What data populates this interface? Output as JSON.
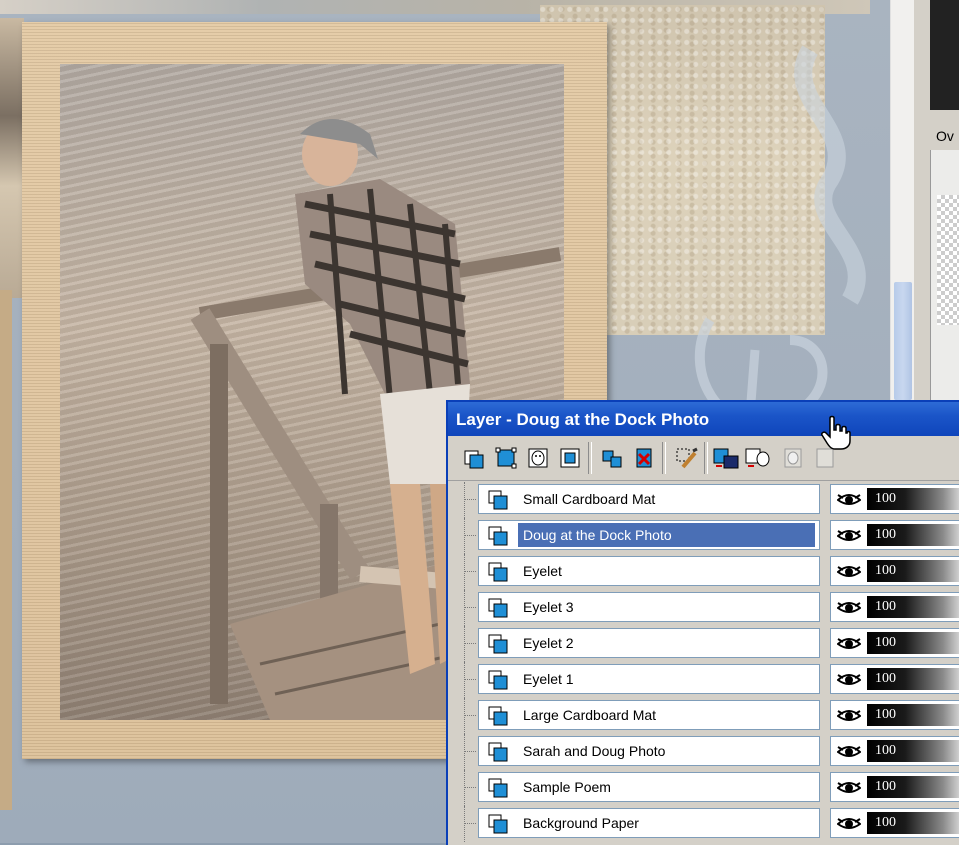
{
  "palette": {
    "title": "Layer - Doug at the Dock Photo",
    "toolbar": [
      {
        "name": "new-raster-layer-icon"
      },
      {
        "name": "new-vector-layer-icon"
      },
      {
        "name": "new-mask-layer-icon"
      },
      {
        "name": "new-adjustment-layer-icon"
      },
      {
        "name": "duplicate-layer-icon"
      },
      {
        "name": "delete-layer-icon"
      },
      {
        "name": "edit-selection-icon"
      },
      {
        "name": "load-mask-icon"
      },
      {
        "name": "hide-mask-icon"
      },
      {
        "name": "disabled-mask-icon"
      },
      {
        "name": "disabled-mask-icon-2"
      }
    ],
    "layers": [
      {
        "name": "Small Cardboard Mat",
        "opacity": "100",
        "selected": false
      },
      {
        "name": "Doug at the Dock Photo",
        "opacity": "100",
        "selected": true
      },
      {
        "name": "Eyelet",
        "opacity": "100",
        "selected": false
      },
      {
        "name": "Eyelet 3",
        "opacity": "100",
        "selected": false
      },
      {
        "name": "Eyelet 2",
        "opacity": "100",
        "selected": false
      },
      {
        "name": "Eyelet 1",
        "opacity": "100",
        "selected": false
      },
      {
        "name": "Large Cardboard Mat",
        "opacity": "100",
        "selected": false
      },
      {
        "name": "Sarah and Doug Photo",
        "opacity": "100",
        "selected": false
      },
      {
        "name": "Sample Poem",
        "opacity": "100",
        "selected": false
      },
      {
        "name": "Background Paper",
        "opacity": "100",
        "selected": false
      }
    ]
  },
  "overview": {
    "tab_label": "Ov"
  },
  "colors": {
    "title_bar": "#1b55c8",
    "selection": "#4a6fb5",
    "panel_face": "#d4d0c8",
    "layer_icon_blue": "#1f8fd6"
  }
}
